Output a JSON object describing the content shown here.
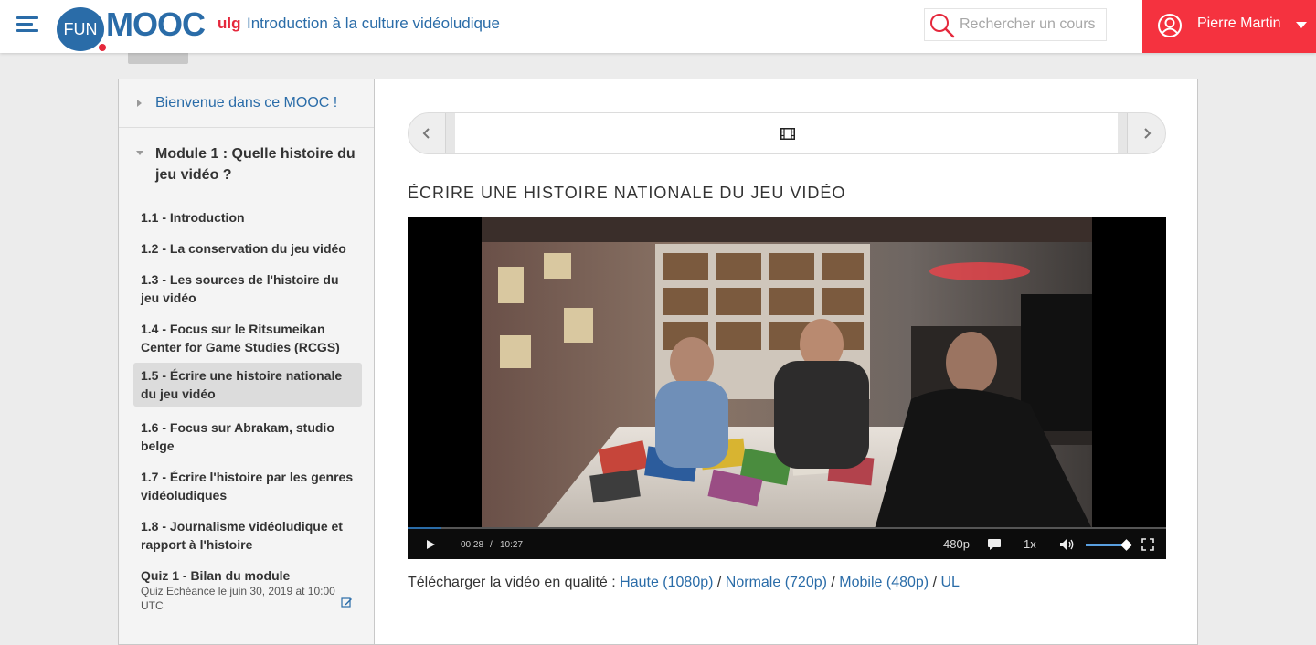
{
  "header": {
    "logo_fun": "FUN",
    "logo_mooc": "MOOC",
    "org": "ulg",
    "course_title": "Introduction à la culture vidéoludique",
    "search_placeholder": "Rechercher un cours",
    "user_name": "Pierre Martin"
  },
  "sidebar": {
    "welcome": "Bienvenue dans ce MOOC !",
    "module_title": "Module 1 : Quelle histoire du jeu vidéo ?",
    "items": [
      {
        "label": "1.1 - Introduction"
      },
      {
        "label": "1.2 - La conservation du jeu vidéo"
      },
      {
        "label": "1.3 - Les sources de l'histoire du jeu vidéo"
      },
      {
        "label": "1.4 - Focus sur le Ritsumeikan Center for Game Studies (RCGS)"
      },
      {
        "label": "1.5 - Écrire une histoire nationale du jeu vidéo",
        "active": true
      },
      {
        "label": "1.6 - Focus sur Abrakam, studio belge"
      },
      {
        "label": "1.7 - Écrire l'histoire par les genres vidéoludiques"
      },
      {
        "label": "1.8 - Journalisme vidéoludique et rapport à l'histoire"
      },
      {
        "label": "Quiz 1 - Bilan du module"
      }
    ],
    "quiz_due": "Quiz Echéance le juin 30, 2019 at 10:00 UTC"
  },
  "unit": {
    "title": "ÉCRIRE UNE HISTOIRE NATIONALE DU JEU VIDÉO"
  },
  "video": {
    "current_time": "00:28",
    "separator": "/",
    "duration": "10:27",
    "progress": 0.045,
    "quality": "480p",
    "speed": "1x",
    "volume": 0.9
  },
  "download": {
    "prefix": "Télécharger la vidéo en qualité :",
    "high": "Haute (1080p)",
    "normal": "Normale (720p)",
    "mobile": "Mobile (480p)",
    "ul": "UL",
    "sep": " / "
  },
  "colors": {
    "brand_blue": "#2a6ca8",
    "brand_red": "#f5323f"
  }
}
